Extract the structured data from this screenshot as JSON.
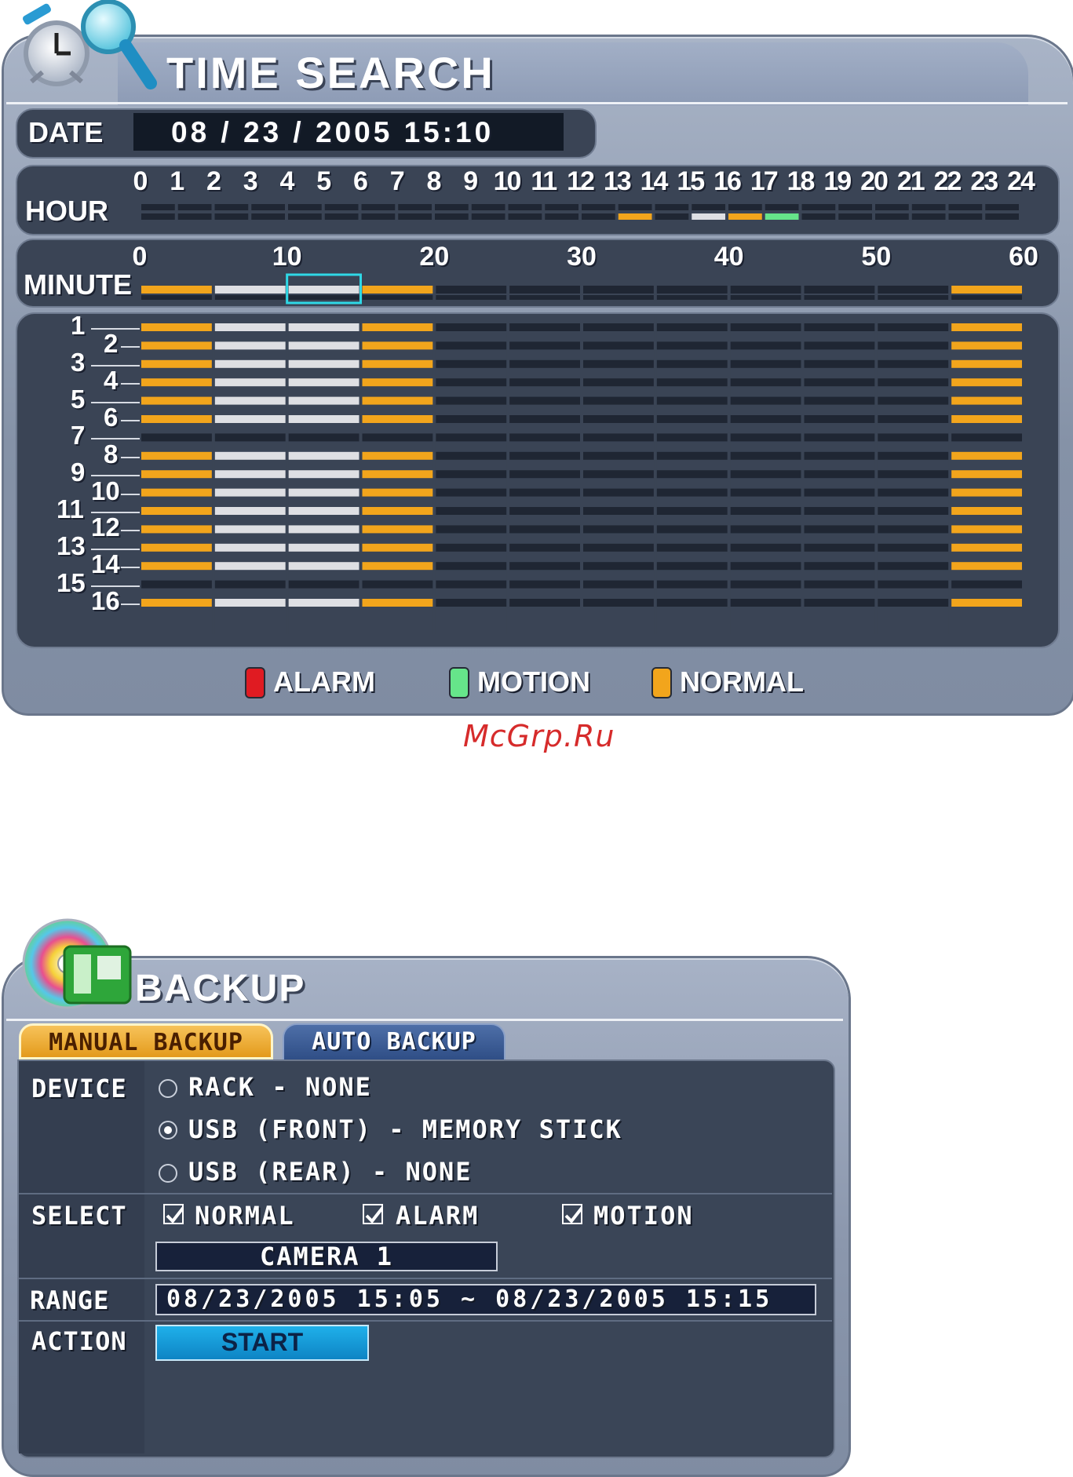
{
  "time_search": {
    "title": "TIME SEARCH",
    "date_label": "DATE",
    "date_value": "08 / 23 / 2005  15:10",
    "hour_label": "HOUR",
    "hour_ticks": [
      "0",
      "1",
      "2",
      "3",
      "4",
      "5",
      "6",
      "7",
      "8",
      "9",
      "10",
      "11",
      "12",
      "13",
      "14",
      "15",
      "16",
      "17",
      "18",
      "19",
      "20",
      "21",
      "22",
      "23",
      "24"
    ],
    "hour_segments": [
      {
        "hour": 13,
        "type": "normal"
      },
      {
        "hour": 15,
        "type": "selected"
      },
      {
        "hour": 16,
        "type": "normal"
      },
      {
        "hour": 17,
        "type": "motion"
      }
    ],
    "minute_label": "MINUTE",
    "minute_ticks": [
      "0",
      "10",
      "20",
      "30",
      "40",
      "50",
      "60"
    ],
    "minute_segments": [
      {
        "start": 0,
        "end": 5,
        "type": "normal"
      },
      {
        "start": 5,
        "end": 15,
        "type": "selected"
      },
      {
        "start": 15,
        "end": 20,
        "type": "normal"
      },
      {
        "start": 55,
        "end": 60,
        "type": "normal"
      }
    ],
    "minute_cursor": {
      "start": 10,
      "end": 15
    },
    "cameras": [
      "1",
      "2",
      "3",
      "4",
      "5",
      "6",
      "7",
      "8",
      "9",
      "10",
      "11",
      "12",
      "13",
      "14",
      "15",
      "16"
    ],
    "camera_pattern": {
      "1": [
        "N",
        "W",
        "W",
        "N",
        "N"
      ],
      "2": [
        "N",
        "W",
        "W",
        "N",
        "N"
      ],
      "3": [
        "N",
        "W",
        "W",
        "N",
        "N"
      ],
      "4": [
        "N",
        "W",
        "W",
        "N",
        "N"
      ],
      "5": [
        "N",
        "W",
        "W",
        "N",
        "N"
      ],
      "6": [
        "N",
        "W",
        "W",
        "N",
        "N"
      ],
      "7": [
        "-",
        "-",
        "-",
        "-",
        "-"
      ],
      "8": [
        "N",
        "W",
        "W",
        "N",
        "N"
      ],
      "9": [
        "N",
        "W",
        "W",
        "N",
        "N"
      ],
      "10": [
        "N",
        "W",
        "W",
        "N",
        "N"
      ],
      "11": [
        "N",
        "W",
        "W",
        "N",
        "N"
      ],
      "12": [
        "N",
        "W",
        "W",
        "N",
        "N"
      ],
      "13": [
        "N",
        "W",
        "W",
        "N",
        "N"
      ],
      "14": [
        "N",
        "W",
        "W",
        "N",
        "N"
      ],
      "15": [
        "-",
        "-",
        "-",
        "-",
        "-"
      ],
      "16": [
        "N",
        "W",
        "W",
        "N",
        "N"
      ]
    },
    "legend": [
      {
        "label": "ALARM",
        "color": "#e01b22"
      },
      {
        "label": "MOTION",
        "color": "#66e58a"
      },
      {
        "label": "NORMAL",
        "color": "#f2a51c"
      }
    ],
    "colors": {
      "normal": "#f2a51c",
      "selected": "#dedfe3",
      "motion": "#66e58a",
      "empty": "#1f2633",
      "cursor": "#2fd8e6"
    }
  },
  "watermark": "McGrp.Ru",
  "backup": {
    "title": "BACKUP",
    "tabs": [
      {
        "label": "MANUAL  BACKUP",
        "active": true
      },
      {
        "label": "AUTO  BACKUP",
        "active": false
      }
    ],
    "device_label": "DEVICE",
    "devices": [
      {
        "label": "RACK  -  NONE",
        "selected": false
      },
      {
        "label": "USB  (FRONT)  -  MEMORY  STICK",
        "selected": true
      },
      {
        "label": "USB  (REAR)  -  NONE",
        "selected": false
      }
    ],
    "select_label": "SELECT",
    "select_options": [
      {
        "label": "NORMAL",
        "checked": true
      },
      {
        "label": "ALARM",
        "checked": true
      },
      {
        "label": "MOTION",
        "checked": true
      }
    ],
    "camera_value": "CAMERA  1",
    "range_label": "RANGE",
    "range_value": "08/23/2005  15:05  ~  08/23/2005  15:15",
    "action_label": "ACTION",
    "start_label": "START"
  }
}
